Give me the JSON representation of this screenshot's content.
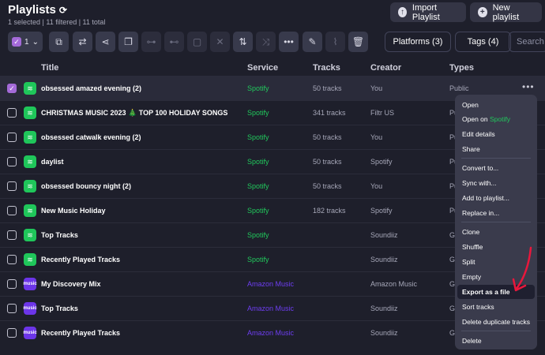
{
  "header": {
    "title": "Playlists",
    "subtitle": "1 selected | 11 filtered | 11 total"
  },
  "top_buttons": {
    "import": "Import Playlist",
    "new": "New playlist"
  },
  "toolbar": {
    "selected_count": "1",
    "platforms": "Platforms (3)",
    "tags": "Tags (4)",
    "search_placeholder": "Search"
  },
  "table": {
    "columns": [
      "Title",
      "Service",
      "Tracks",
      "Creator",
      "Types"
    ],
    "rows": [
      {
        "title": "obsessed amazed evening (2)",
        "service": "Spotify",
        "tracks": "50 tracks",
        "creator": "You",
        "type": "Public",
        "selected": true
      },
      {
        "title": "CHRISTMAS MUSIC 2023 🎄 TOP 100 HOLIDAY SONGS",
        "service": "Spotify",
        "tracks": "341 tracks",
        "creator": "Filtr US",
        "type": "Pu"
      },
      {
        "title": "obsessed catwalk evening (2)",
        "service": "Spotify",
        "tracks": "50 tracks",
        "creator": "You",
        "type": "Pu"
      },
      {
        "title": "daylist",
        "service": "Spotify",
        "tracks": "50 tracks",
        "creator": "Spotify",
        "type": "Pu"
      },
      {
        "title": "obsessed bouncy night (2)",
        "service": "Spotify",
        "tracks": "50 tracks",
        "creator": "You",
        "type": "Pu"
      },
      {
        "title": "New Music Holiday",
        "service": "Spotify",
        "tracks": "182 tracks",
        "creator": "Spotify",
        "type": "Pu"
      },
      {
        "title": "Top Tracks",
        "service": "Spotify",
        "tracks": "",
        "creator": "Soundiiz",
        "type": "G"
      },
      {
        "title": "Recently Played Tracks",
        "service": "Spotify",
        "tracks": "",
        "creator": "Soundiiz",
        "type": "G"
      },
      {
        "title": "My Discovery Mix",
        "service": "Amazon Music",
        "tracks": "",
        "creator": "Amazon Music",
        "type": "G"
      },
      {
        "title": "Top Tracks",
        "service": "Amazon Music",
        "tracks": "",
        "creator": "Soundiiz",
        "type": "G"
      },
      {
        "title": "Recently Played Tracks",
        "service": "Amazon Music",
        "tracks": "",
        "creator": "Soundiiz",
        "type": "G"
      }
    ]
  },
  "context_menu": {
    "open": "Open",
    "open_on_prefix": "Open on ",
    "open_on_service": "Spotify",
    "edit_details": "Edit details",
    "share": "Share",
    "convert_to": "Convert to...",
    "sync_with": "Sync with...",
    "add_to_playlist": "Add to playlist...",
    "replace_in": "Replace in...",
    "clone": "Clone",
    "shuffle": "Shuffle",
    "split": "Split",
    "empty": "Empty",
    "export_as_file": "Export as a file",
    "sort_tracks": "Sort tracks",
    "delete_duplicate_tracks": "Delete duplicate tracks",
    "delete": "Delete"
  },
  "colors": {
    "background": "#1e1f2b",
    "spotify_green": "#21c75c",
    "amazon_purple": "#6d3df0",
    "checkbox_accent": "#a46ad8",
    "annotation_arrow": "#e8173c"
  },
  "icons": {
    "sync": "refresh-icon",
    "import": "cloud-upload-icon",
    "new": "plus-circle-icon",
    "spotify": "spotify-icon",
    "amazon": "amazon-music-icon",
    "more": "more-dots-icon",
    "arrow": "red-arrow-annotation"
  }
}
